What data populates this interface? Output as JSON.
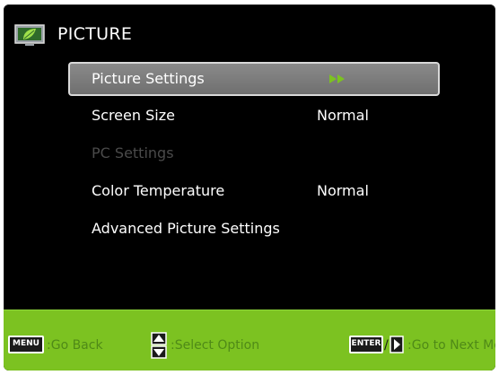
{
  "header": {
    "title": "PICTURE",
    "icon": "leaf-picture-icon"
  },
  "menu": {
    "items": [
      {
        "label": "Picture Settings",
        "value": "",
        "state": "selected",
        "has_arrow": true
      },
      {
        "label": "Screen Size",
        "value": "Normal",
        "state": "normal"
      },
      {
        "label": "PC Settings",
        "value": "",
        "state": "disabled"
      },
      {
        "label": "Color Temperature",
        "value": "Normal",
        "state": "normal"
      },
      {
        "label": "Advanced Picture Settings",
        "value": "",
        "state": "normal"
      }
    ]
  },
  "footer": {
    "menu_key": "MENU",
    "go_back": ":Go Back",
    "select_option": ":Select Option",
    "enter_key": "ENTER",
    "slash": "/",
    "next_menu": ":Go to Next Menu"
  },
  "colors": {
    "footer_bg": "#7cc221",
    "footer_text": "#4f8a17",
    "selected_bg": "#7f7f7f",
    "disabled_text": "#4a4a4a",
    "arrow": "#7cc221"
  }
}
